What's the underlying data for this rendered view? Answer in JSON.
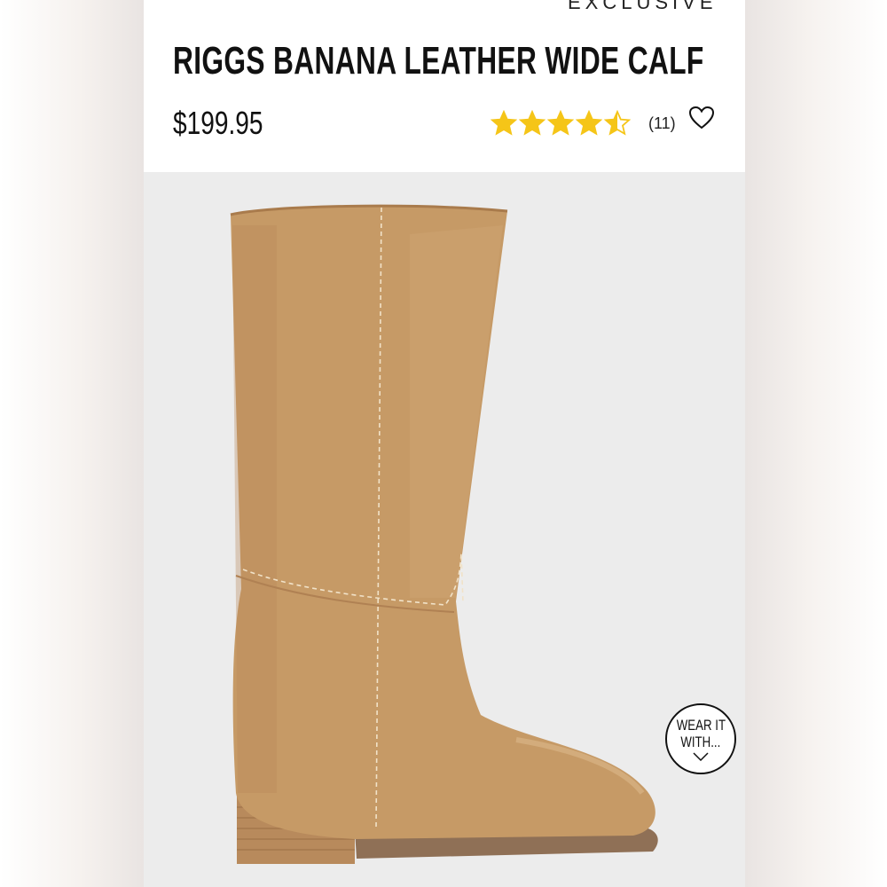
{
  "product": {
    "badge": "EXCLUSIVE",
    "title": "RIGGS BANANA LEATHER WIDE CALF",
    "price": "$199.95",
    "rating_value": 4.5,
    "rating_max": 5,
    "review_count": "(11)",
    "image_subject": "tan leather knee-high boot with wooden block heel"
  },
  "icons": {
    "wishlist": "heart-outline-icon",
    "star": "star-icon",
    "chevron": "chevron-down-icon"
  },
  "wear_it": {
    "line1": "WEAR IT",
    "line2": "WITH..."
  },
  "colors": {
    "star": "#f5c518",
    "boot": "#c69a66",
    "heel": "#b88a5c",
    "background": "#ececec"
  }
}
